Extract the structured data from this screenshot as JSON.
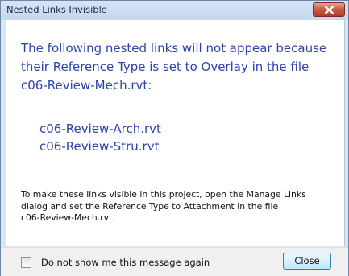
{
  "window": {
    "title": "Nested Links Invisible"
  },
  "message": {
    "instruction_lines": [
      "The following nested links will not appear because",
      "their Reference Type is set to Overlay in the file",
      "c06-Review-Mech.rvt:"
    ],
    "links": [
      "c06-Review-Arch.rvt",
      "c06-Review-Stru.rvt"
    ],
    "footnote_lines": [
      "To make these links visible in this project, open the Manage Links",
      "dialog and set the Reference Type to Attachment in the file",
      "c06-Review-Mech.rvt."
    ]
  },
  "footer": {
    "checkbox_label": "Do not show me this message again",
    "checkbox_checked": false,
    "close_label": "Close"
  },
  "icons": {
    "window_close": "close-icon"
  },
  "colors": {
    "instruction_text": "#2c43a8",
    "close_button_red": "#c75a42",
    "title_bar": "#c4d7ee"
  }
}
